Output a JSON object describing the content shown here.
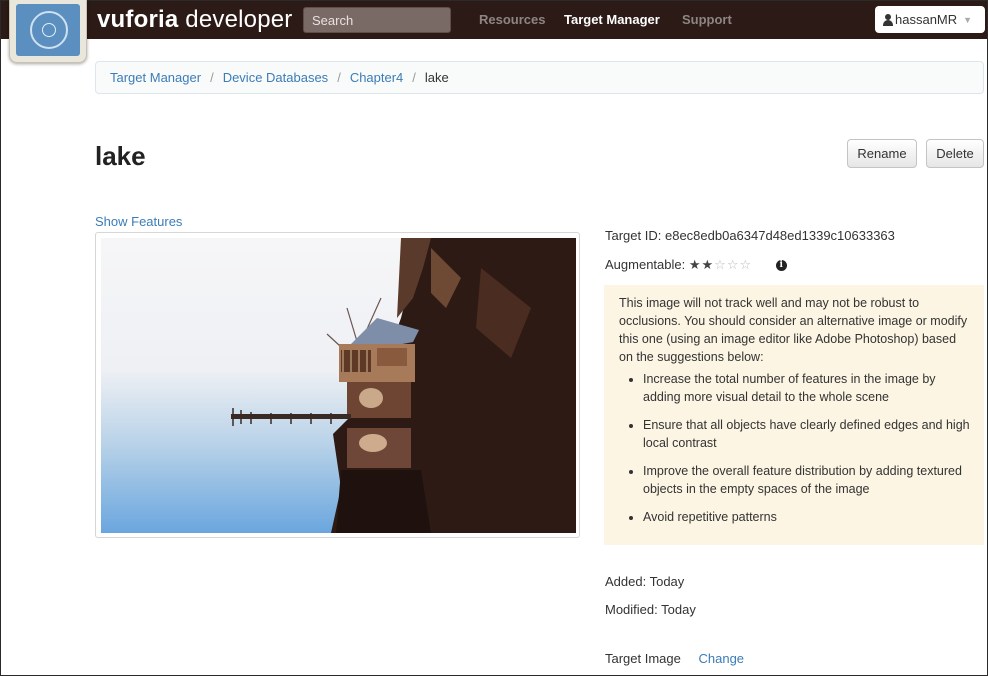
{
  "header": {
    "brand_bold": "vuforia",
    "brand_rest": " developer",
    "search_placeholder": "Search",
    "nav": [
      "Resources",
      "Target Manager",
      "Support"
    ],
    "active_nav": "Target Manager",
    "username": "hassanMR"
  },
  "breadcrumb": {
    "items": [
      "Target Manager",
      "Device Databases",
      "Chapter4"
    ],
    "current": "lake"
  },
  "page": {
    "title": "lake",
    "rename_label": "Rename",
    "delete_label": "Delete",
    "show_features_label": "Show Features"
  },
  "details": {
    "target_id_label": "Target ID:",
    "target_id": "e8ec8edb0a6347d48ed1339c10633363",
    "augmentable_label": "Augmentable:",
    "augmentable_rating": 2,
    "augmentable_max": 5,
    "warning_intro": "This image will not track well and may not be robust to occlusions. You should consider an alternative image or modify this one (using an image editor like Adobe Photoshop) based on the suggestions below:",
    "suggestions": [
      "Increase the total number of features in the image by adding more visual detail to the whole scene",
      "Ensure that all objects have clearly defined edges and high local contrast",
      "Improve the overall feature distribution by adding textured objects in the empty spaces of the image",
      "Avoid repetitive patterns"
    ],
    "added_label": "Added:",
    "added_value": "Today",
    "modified_label": "Modified:",
    "modified_value": "Today",
    "target_image_label": "Target Image",
    "change_label": "Change"
  },
  "colors": {
    "topbar": "#2b1a16",
    "link": "#3b7cb8",
    "warning_bg": "#fcf5e3"
  }
}
